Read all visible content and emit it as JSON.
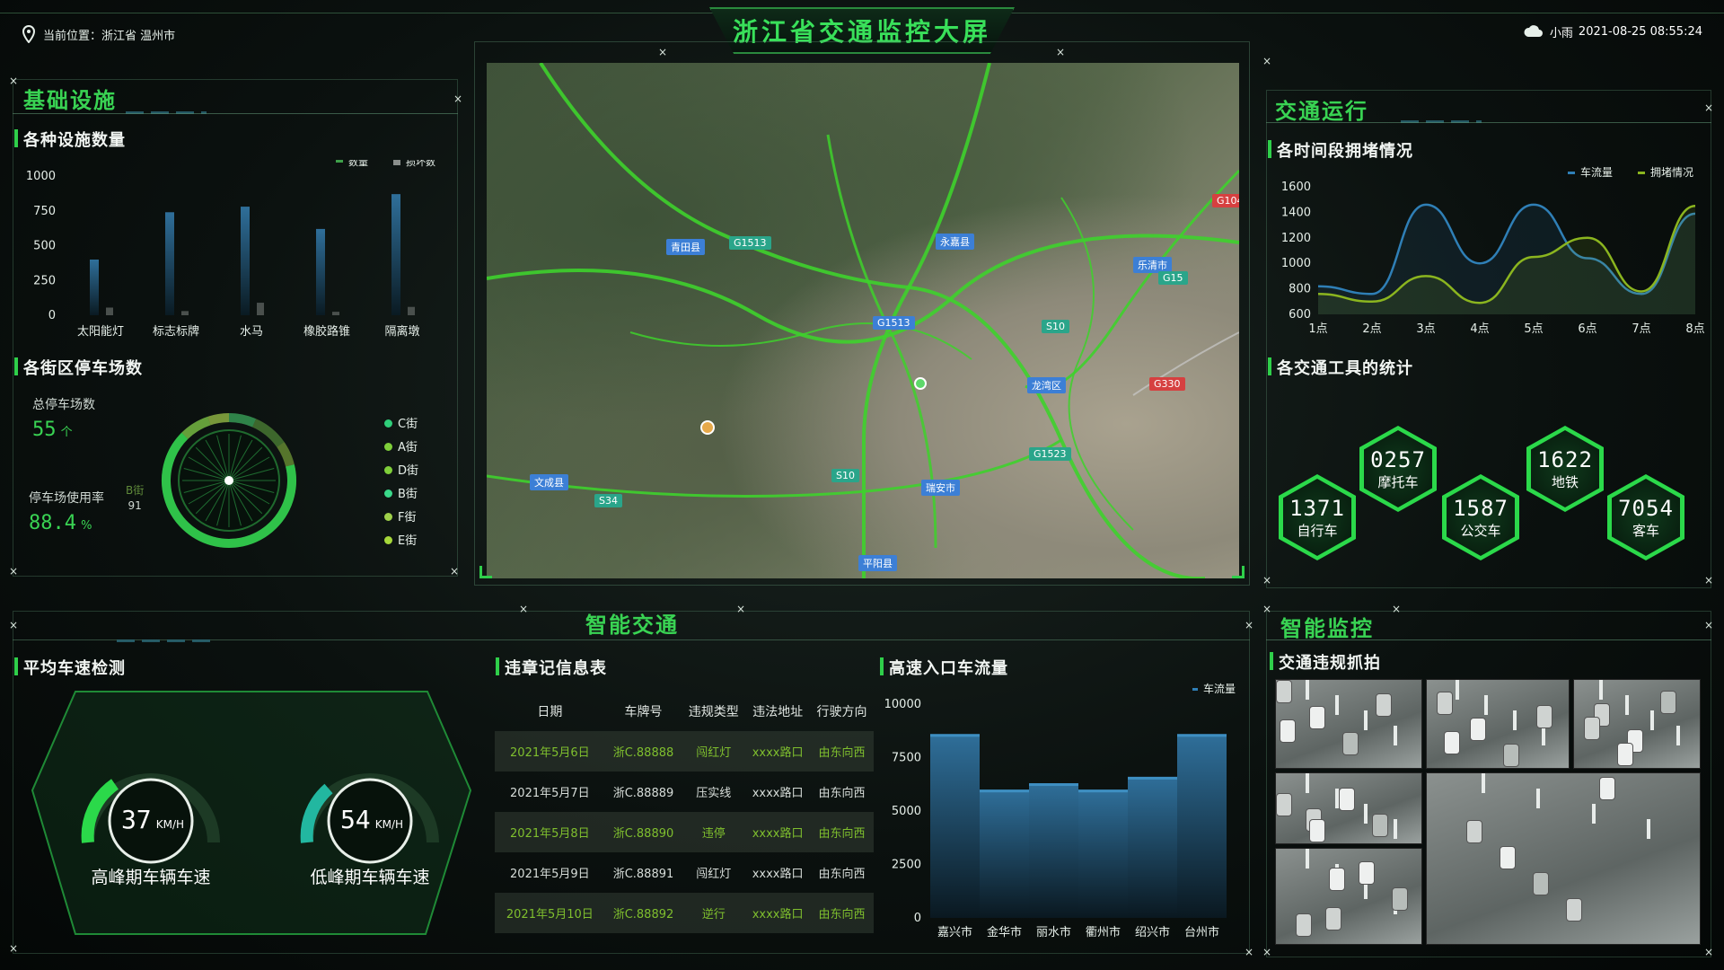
{
  "header": {
    "location_label": "当前位置：浙江省 温州市",
    "title": "浙江省交通监控大屏",
    "weather": "小雨",
    "datetime": "2021-08-25 08:55:24"
  },
  "left": {
    "title": "基础设施",
    "facilities": {
      "subtitle": "各种设施数量",
      "legend": [
        "数量",
        "损坏数"
      ],
      "y_ticks": [
        "1000",
        "750",
        "500",
        "250",
        "0"
      ]
    },
    "parking": {
      "subtitle": "各街区停车场数",
      "total_label": "总停车场数",
      "total_value": "55",
      "total_unit": "个",
      "rate_label": "停车场使用率",
      "rate_value": "88.4",
      "rate_unit": "%",
      "b_street_label": "B街",
      "b_street_value": "91",
      "legend": [
        "C街",
        "A街",
        "D街",
        "B街",
        "F街",
        "E街"
      ]
    }
  },
  "right": {
    "title": "交通运行",
    "congestion": {
      "subtitle": "各时间段拥堵情况",
      "legend": [
        "车流量",
        "拥堵情况"
      ],
      "y_ticks": [
        "1600",
        "1400",
        "1200",
        "1000",
        "800",
        "600"
      ]
    },
    "vehicles": {
      "subtitle": "各交通工具的统计",
      "items": [
        {
          "label": "自行车",
          "value": "1371"
        },
        {
          "label": "摩托车",
          "value": "0257"
        },
        {
          "label": "公交车",
          "value": "1587"
        },
        {
          "label": "地铁",
          "value": "1622"
        },
        {
          "label": "客车",
          "value": "7054"
        }
      ]
    }
  },
  "bottom": {
    "title": "智能交通",
    "speed": {
      "subtitle": "平均车速检测",
      "gauges": [
        {
          "value": "37",
          "unit": "KM/H",
          "label": "高峰期车辆车速"
        },
        {
          "value": "54",
          "unit": "KM/H",
          "label": "低峰期车辆车速"
        }
      ]
    },
    "violations": {
      "subtitle": "违章记信息表",
      "headers": [
        "日期",
        "车牌号",
        "违规类型",
        "违法地址",
        "行驶方向"
      ],
      "rows": [
        [
          "2021年5月6日",
          "浙C.88888",
          "闯红灯",
          "xxxx路口",
          "由东向西"
        ],
        [
          "2021年5月7日",
          "浙C.88889",
          "压实线",
          "xxxx路口",
          "由东向西"
        ],
        [
          "2021年5月8日",
          "浙C.88890",
          "违停",
          "xxxx路口",
          "由东向西"
        ],
        [
          "2021年5月9日",
          "浙C.88891",
          "闯红灯",
          "xxxx路口",
          "由东向西"
        ],
        [
          "2021年5月10日",
          "浙C.88892",
          "逆行",
          "xxxx路口",
          "由东向西"
        ]
      ]
    },
    "highway": {
      "subtitle": "高速入口车流量",
      "legend": "车流量",
      "y_ticks": [
        "10000",
        "7500",
        "5000",
        "2500",
        "0"
      ]
    }
  },
  "monitor": {
    "title": "智能监控",
    "subtitle": "交通违规抓拍"
  },
  "map_labels": [
    "青田县",
    "永嘉县",
    "乐清市",
    "G1513",
    "G1513",
    "G104",
    "G15",
    "S10",
    "龙湾区",
    "G330",
    "G1523",
    "S10",
    "瑞安市",
    "文成县",
    "S34",
    "平阳县"
  ],
  "chart_data": [
    {
      "type": "bar",
      "title": "各种设施数量",
      "categories": [
        "太阳能灯",
        "标志标牌",
        "水马",
        "橡胶路锥",
        "隔离墩"
      ],
      "series": [
        {
          "name": "数量",
          "values": [
            400,
            740,
            780,
            620,
            870
          ]
        },
        {
          "name": "损坏数",
          "values": [
            55,
            30,
            90,
            25,
            60
          ]
        }
      ],
      "ylim": [
        0,
        1000
      ],
      "legend_position": "top-right"
    },
    {
      "type": "line",
      "title": "各时间段拥堵情况",
      "x": [
        "1点",
        "2点",
        "3点",
        "4点",
        "5点",
        "6点",
        "7点",
        "8点"
      ],
      "series": [
        {
          "name": "车流量",
          "values": [
            820,
            760,
            1460,
            1000,
            1460,
            1040,
            760,
            1390
          ]
        },
        {
          "name": "拥堵情况",
          "values": [
            760,
            700,
            900,
            690,
            1050,
            1200,
            780,
            1450
          ]
        }
      ],
      "ylim": [
        600,
        1600
      ],
      "colors": [
        "#2f7fb6",
        "#8bb51f"
      ],
      "legend_position": "top-right"
    },
    {
      "type": "bar",
      "title": "高速入口车流量",
      "categories": [
        "嘉兴市",
        "金华市",
        "丽水市",
        "衢州市",
        "绍兴市",
        "台州市"
      ],
      "series": [
        {
          "name": "车流量",
          "values": [
            8600,
            6000,
            6300,
            6000,
            6600,
            8600
          ]
        }
      ],
      "ylim": [
        0,
        10000
      ],
      "legend_position": "top-right"
    },
    {
      "type": "pie",
      "title": "各街区停车场数",
      "categories": [
        "C街",
        "A街",
        "D街",
        "B街",
        "F街",
        "E街"
      ],
      "values": [
        9,
        12,
        8,
        91,
        10,
        7
      ]
    }
  ],
  "colors": {
    "accent": "#39d353",
    "bar_blue": "#1f5f8a",
    "line_blue": "#2f7fb6",
    "line_green": "#8bb51f"
  }
}
